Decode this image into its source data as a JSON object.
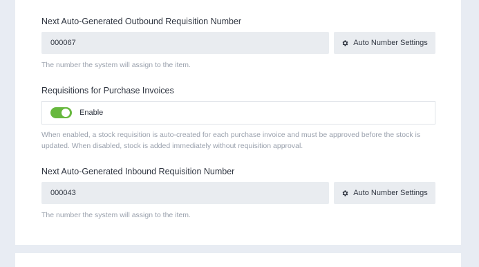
{
  "outbound": {
    "label": "Next Auto-Generated Outbound Requisition Number",
    "value": "000067",
    "button_label": "Auto Number Settings",
    "help": "The number the system will assign to the item."
  },
  "purchase_invoices": {
    "label": "Requisitions for Purchase Invoices",
    "toggle_label": "Enable",
    "enabled": true,
    "help_line1": "When enabled, a stock requisition is auto-created for each purchase invoice and must be approved before the stock is",
    "help_line2": "updated. When disabled, stock is added immediately without requisition approval."
  },
  "inbound": {
    "label": "Next Auto-Generated Inbound Requisition Number",
    "value": "000043",
    "button_label": "Auto Number Settings",
    "help": "The number the system will assign to the item."
  },
  "colors": {
    "toggle_on": "#67b83e",
    "input_bg": "#e9ecf0",
    "page_bg": "#e8ecf3"
  },
  "icons": {
    "settings": "gear-icon"
  }
}
